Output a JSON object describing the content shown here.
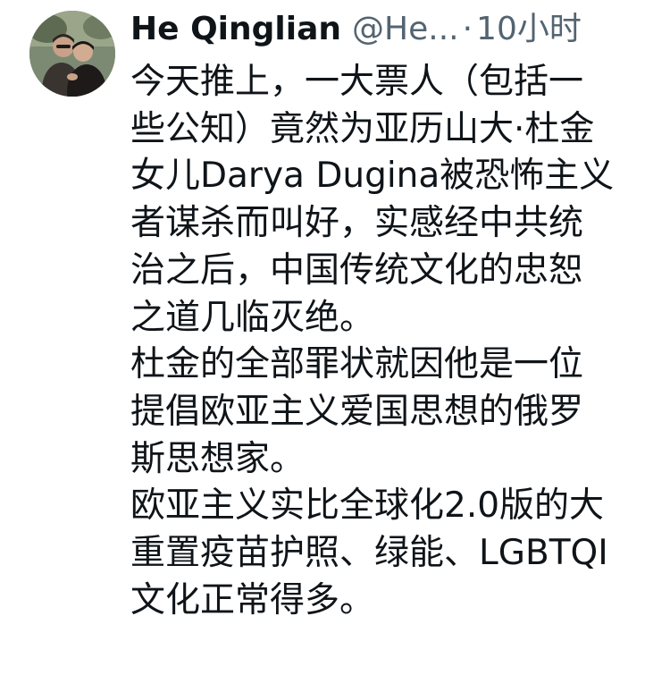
{
  "author": {
    "display_name": "He Qinglian",
    "handle": "@He...",
    "separator": "·",
    "timestamp": "10小时"
  },
  "tweet": {
    "paragraphs": [
      "今天推上，一大票人（包括一\n些公知）竟然为亚历山大·杜金\n女儿Darya Dugina被恐怖主义\n者谋杀而叫好，实感经中共统\n治之后，中国传统文化的忠恕\n之道几临灭绝。",
      "杜金的全部罪状就因他是一位\n提倡欧亚主义爱国思想的俄罗\n斯思想家。",
      "欧亚主义实比全球化2.0版的大\n重置疫苗护照、绿能、LGBTQI\n文化正常得多。"
    ]
  },
  "colors": {
    "text_primary": "#0f1419",
    "text_secondary": "#536471",
    "background": "#ffffff"
  }
}
